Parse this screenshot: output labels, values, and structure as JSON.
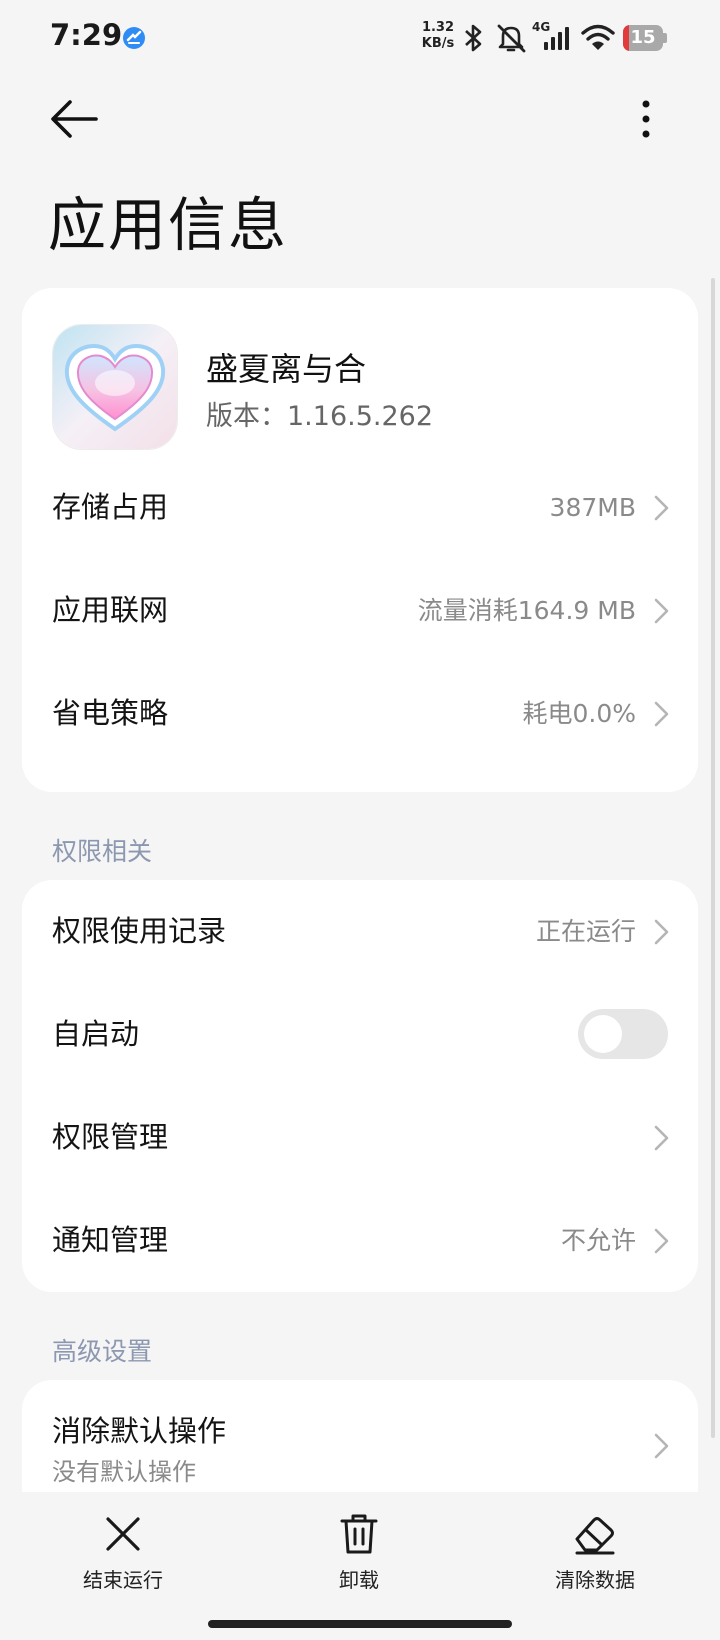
{
  "status_bar": {
    "time": "7:29",
    "net_speed_value": "1.32",
    "net_speed_unit": "KB/s",
    "network_type": "4G",
    "battery_level": "15",
    "battery_fraction": 0.15,
    "icons": [
      "app-badge-icon",
      "bluetooth-icon",
      "mute-icon",
      "cellular-signal-icon",
      "wifi-icon",
      "battery-icon"
    ],
    "colors": {
      "battery_low": "#e2393c",
      "app_badge": "#2f8cf5"
    }
  },
  "header": {
    "title": "应用信息",
    "icons": [
      "back-arrow-icon",
      "more-vertical-icon"
    ]
  },
  "app": {
    "name": "盛夏离与合",
    "version": "版本：1.16.5.262",
    "icon": "heart-app-icon"
  },
  "app_rows": [
    {
      "label": "存储占用",
      "value": "387MB"
    },
    {
      "label": "应用联网",
      "value": "流量消耗164.9 MB"
    },
    {
      "label": "省电策略",
      "value": "耗电0.0%"
    }
  ],
  "permission_section": {
    "title": "权限相关",
    "rows": [
      {
        "label": "权限使用记录",
        "value": "正在运行"
      },
      {
        "label": "自启动",
        "toggle_on": false
      },
      {
        "label": "权限管理",
        "value": ""
      },
      {
        "label": "通知管理",
        "value": "不允许"
      }
    ]
  },
  "advanced_section": {
    "title": "高级设置",
    "rows": [
      {
        "label": "消除默认操作",
        "sub": "没有默认操作"
      }
    ]
  },
  "bottom_bar": [
    {
      "label": "结束运行",
      "icon": "close-icon"
    },
    {
      "label": "卸载",
      "icon": "trash-icon"
    },
    {
      "label": "清除数据",
      "icon": "eraser-icon"
    }
  ]
}
